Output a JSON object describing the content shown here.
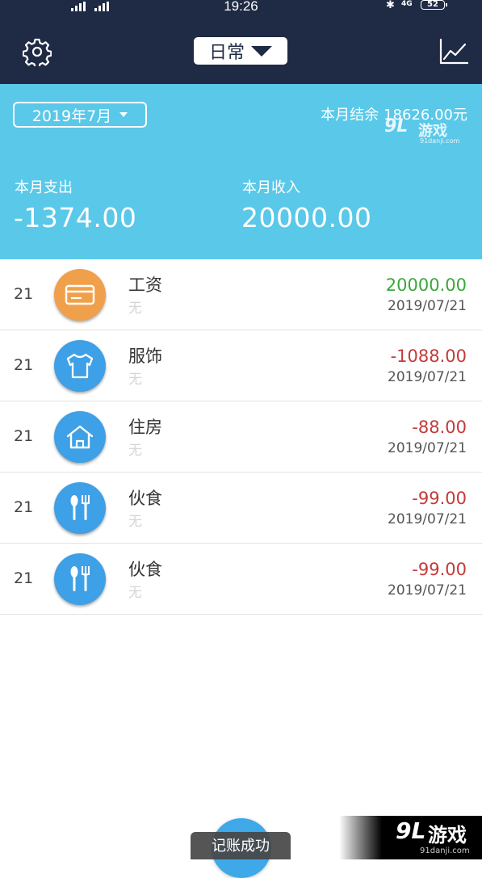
{
  "status_bar": {
    "time": "19:26",
    "network": "4G",
    "battery": "52"
  },
  "header": {
    "settings_icon": "gear-icon",
    "book_label": "日常",
    "chart_icon": "line-chart-icon"
  },
  "summary": {
    "month": "2019年7月",
    "balance_label": "本月结余",
    "balance_value": "18626.00元",
    "expense_label": "本月支出",
    "expense_value": "-1374.00",
    "income_label": "本月收入",
    "income_value": "20000.00",
    "background_color": "#5ac8e8"
  },
  "records": [
    {
      "day": "21",
      "category": "工资",
      "memo": "无",
      "amount": "20000.00",
      "date": "2019/07/21",
      "type": "income",
      "icon": "card-icon"
    },
    {
      "day": "21",
      "category": "服饰",
      "memo": "无",
      "amount": "-1088.00",
      "date": "2019/07/21",
      "type": "expense",
      "icon": "shirt-icon"
    },
    {
      "day": "21",
      "category": "住房",
      "memo": "无",
      "amount": "-88.00",
      "date": "2019/07/21",
      "type": "expense",
      "icon": "house-icon"
    },
    {
      "day": "21",
      "category": "伙食",
      "memo": "无",
      "amount": "-99.00",
      "date": "2019/07/21",
      "type": "expense",
      "icon": "utensils-icon"
    },
    {
      "day": "21",
      "category": "伙食",
      "memo": "无",
      "amount": "-99.00",
      "date": "2019/07/21",
      "type": "expense",
      "icon": "utensils-icon"
    }
  ],
  "toast": "记账成功",
  "watermarks": {
    "top": {
      "logo": "9L",
      "brand": "游戏",
      "url": "91danji.com"
    },
    "bottom": {
      "logo": "9L",
      "brand": "游戏",
      "url": "91danji.com"
    }
  }
}
